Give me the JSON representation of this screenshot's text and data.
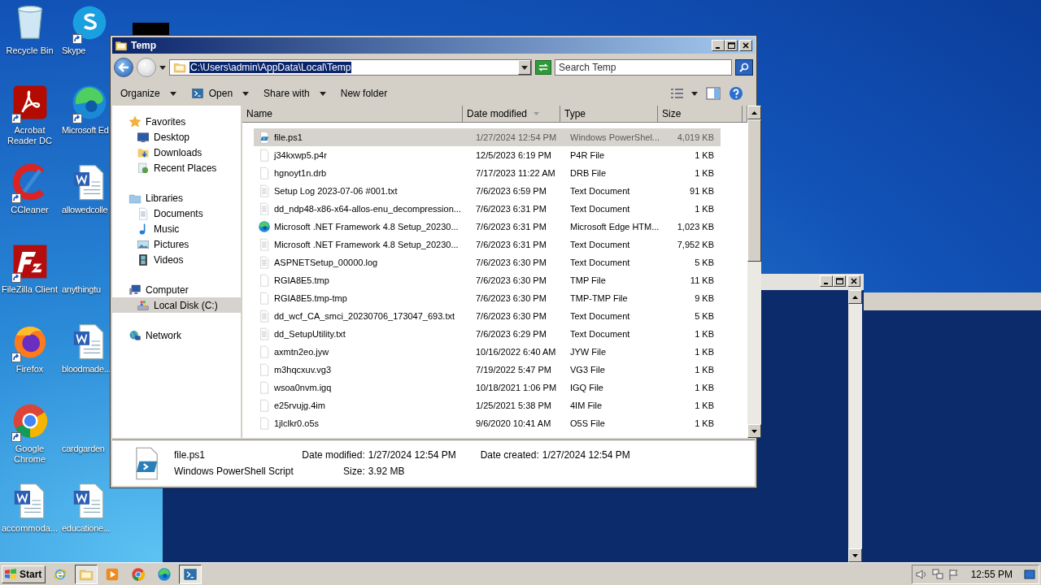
{
  "desktop": {
    "icons": [
      {
        "label": "Recycle Bin",
        "kind": "recycle",
        "shortcut": false
      },
      {
        "label": "Skype",
        "kind": "skype",
        "shortcut": true
      },
      {
        "label": "Acrobat Reader DC",
        "kind": "acrobat",
        "shortcut": true
      },
      {
        "label": "Microsoft Ed",
        "kind": "edge",
        "shortcut": true
      },
      {
        "label": "CCleaner",
        "kind": "ccleaner",
        "shortcut": true
      },
      {
        "label": "allowedcolle",
        "kind": "word",
        "shortcut": false
      },
      {
        "label": "FileZilla Client",
        "kind": "filezilla",
        "shortcut": true
      },
      {
        "label": "anythingtu",
        "kind": "blank",
        "shortcut": false
      },
      {
        "label": "Firefox",
        "kind": "firefox",
        "shortcut": true
      },
      {
        "label": "bloodmade...",
        "kind": "word",
        "shortcut": false
      },
      {
        "label": "Google Chrome",
        "kind": "chrome",
        "shortcut": true
      },
      {
        "label": "cardgarden",
        "kind": "blank",
        "shortcut": false
      },
      {
        "label": "accommoda...",
        "kind": "word",
        "shortcut": false
      },
      {
        "label": "educatione...",
        "kind": "word",
        "shortcut": false
      }
    ]
  },
  "explorer": {
    "title": "Temp",
    "address": "C:\\Users\\admin\\AppData\\Local\\Temp",
    "search": {
      "placeholder": "Search Temp"
    },
    "toolbar": [
      {
        "label": "Organize",
        "kind": "menu"
      },
      {
        "label": "Open",
        "kind": "open"
      },
      {
        "label": "Share with",
        "kind": "menu"
      },
      {
        "label": "New folder",
        "kind": "plain"
      }
    ],
    "nav": [
      {
        "label": "Favorites",
        "kind": "star",
        "selected": false,
        "children": [
          {
            "label": "Desktop",
            "kind": "desktop",
            "selected": false
          },
          {
            "label": "Downloads",
            "kind": "downloads",
            "selected": false
          },
          {
            "label": "Recent Places",
            "kind": "recent",
            "selected": false
          }
        ]
      },
      {
        "label": "Libraries",
        "kind": "libraries",
        "selected": false,
        "children": [
          {
            "label": "Documents",
            "kind": "documents",
            "selected": false
          },
          {
            "label": "Music",
            "kind": "music",
            "selected": false
          },
          {
            "label": "Pictures",
            "kind": "pictures",
            "selected": false
          },
          {
            "label": "Videos",
            "kind": "videos",
            "selected": false
          }
        ]
      },
      {
        "label": "Computer",
        "kind": "computer",
        "selected": false,
        "children": [
          {
            "label": "Local Disk (C:)",
            "kind": "disk",
            "selected": true
          }
        ]
      },
      {
        "label": "Network",
        "kind": "network",
        "selected": false
      }
    ],
    "columns": [
      {
        "label": "Name",
        "sorted": false
      },
      {
        "label": "Date modified",
        "sorted": true
      },
      {
        "label": "Type",
        "sorted": false
      },
      {
        "label": "Size",
        "sorted": false
      }
    ],
    "rows": [
      {
        "name": "file.ps1",
        "date": "1/27/2024 12:54 PM",
        "type": "Windows PowerShel...",
        "size": "4,019 KB",
        "kind": "script",
        "selected": true
      },
      {
        "name": "j34kxwp5.p4r",
        "date": "12/5/2023 6:19 PM",
        "type": "P4R File",
        "size": "1 KB",
        "kind": "file",
        "selected": false
      },
      {
        "name": "hgnoyt1n.drb",
        "date": "7/17/2023 11:22 AM",
        "type": "DRB File",
        "size": "1 KB",
        "kind": "file",
        "selected": false
      },
      {
        "name": "Setup Log 2023-07-06 #001.txt",
        "date": "7/6/2023 6:59 PM",
        "type": "Text Document",
        "size": "91 KB",
        "kind": "text",
        "selected": false
      },
      {
        "name": "dd_ndp48-x86-x64-allos-enu_decompression...",
        "date": "7/6/2023 6:31 PM",
        "type": "Text Document",
        "size": "1 KB",
        "kind": "text",
        "selected": false
      },
      {
        "name": "Microsoft .NET Framework 4.8 Setup_20230...",
        "date": "7/6/2023 6:31 PM",
        "type": "Microsoft Edge HTM...",
        "size": "1,023 KB",
        "kind": "edge",
        "selected": false
      },
      {
        "name": "Microsoft .NET Framework 4.8 Setup_20230...",
        "date": "7/6/2023 6:31 PM",
        "type": "Text Document",
        "size": "7,952 KB",
        "kind": "text",
        "selected": false
      },
      {
        "name": "ASPNETSetup_00000.log",
        "date": "7/6/2023 6:30 PM",
        "type": "Text Document",
        "size": "5 KB",
        "kind": "text",
        "selected": false
      },
      {
        "name": "RGIA8E5.tmp",
        "date": "7/6/2023 6:30 PM",
        "type": "TMP File",
        "size": "11 KB",
        "kind": "file",
        "selected": false
      },
      {
        "name": "RGIA8E5.tmp-tmp",
        "date": "7/6/2023 6:30 PM",
        "type": "TMP-TMP File",
        "size": "9 KB",
        "kind": "file",
        "selected": false
      },
      {
        "name": "dd_wcf_CA_smci_20230706_173047_693.txt",
        "date": "7/6/2023 6:30 PM",
        "type": "Text Document",
        "size": "5 KB",
        "kind": "text",
        "selected": false
      },
      {
        "name": "dd_SetupUtility.txt",
        "date": "7/6/2023 6:29 PM",
        "type": "Text Document",
        "size": "1 KB",
        "kind": "text",
        "selected": false
      },
      {
        "name": "axmtn2eo.jyw",
        "date": "10/16/2022 6:40 AM",
        "type": "JYW File",
        "size": "1 KB",
        "kind": "file",
        "selected": false
      },
      {
        "name": "m3hqcxuv.vg3",
        "date": "7/19/2022 5:47 PM",
        "type": "VG3 File",
        "size": "1 KB",
        "kind": "file",
        "selected": false
      },
      {
        "name": "wsoa0nvm.igq",
        "date": "10/18/2021 1:06 PM",
        "type": "IGQ File",
        "size": "1 KB",
        "kind": "file",
        "selected": false
      },
      {
        "name": "e25rvujg.4im",
        "date": "1/25/2021 5:38 PM",
        "type": "4IM File",
        "size": "1 KB",
        "kind": "file",
        "selected": false
      },
      {
        "name": "1jlclkr0.o5s",
        "date": "9/6/2020 10:41 AM",
        "type": "O5S File",
        "size": "1 KB",
        "kind": "file",
        "selected": false
      }
    ],
    "details": {
      "name": "file.ps1",
      "type": "Windows PowerShell Script",
      "lines": [
        [
          {
            "label": "Date modified:",
            "value": "1/27/2024 12:54 PM"
          },
          {
            "label": "Date created:",
            "value": "1/27/2024 12:54 PM"
          }
        ],
        [
          {
            "label": "Size:",
            "value": "3.92 MB"
          }
        ]
      ]
    }
  },
  "taskbar": {
    "start": "Start",
    "apps": [
      {
        "kind": "ie",
        "active": false
      },
      {
        "kind": "folder",
        "active": true
      },
      {
        "kind": "media",
        "active": false
      },
      {
        "kind": "chrome",
        "active": false
      },
      {
        "kind": "edge",
        "active": false
      },
      {
        "kind": "powershell",
        "active": true
      }
    ],
    "clock": "12:55 PM"
  }
}
